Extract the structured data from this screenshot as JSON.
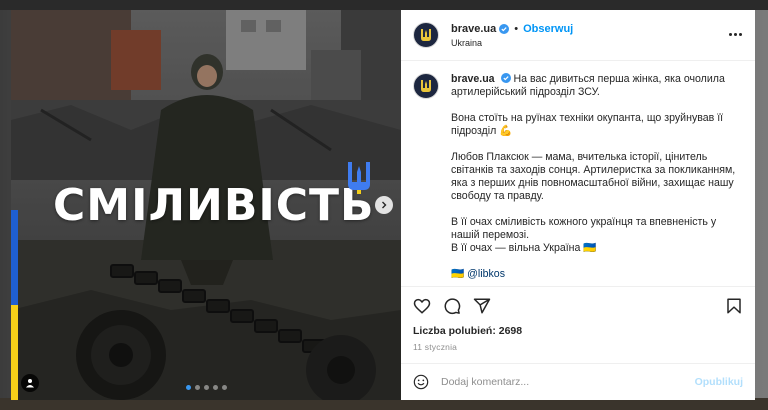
{
  "post": {
    "headline": "СМІЛИВІСТЬ",
    "dots_count": 5,
    "active_dot": 0
  },
  "header": {
    "username": "brave.ua",
    "separator": "•",
    "follow_label": "Obserwuj",
    "location": "Ukraina"
  },
  "caption": {
    "username": "brave.ua",
    "line1": "На вас дивиться перша жінка, яка очолила артилерійський підрозділ ЗСУ.",
    "para2": "Вона стоїть на руїнах техніки окупанта, що зруйнував її підрозділ 💪",
    "para3": "Любов Плаксюк — мама, вчителька історії, цінитель світанків та заходів сонця. Артилеристка за покликанням, яка з перших днів повномасштабної війни, захищає нашу свободу та правду.",
    "para4a": "В її очах сміливість кожного українця та впевненість у нашій перемозі.",
    "para4b": "В її очах — вільна Україна 🇺🇦",
    "mention_flag": "🇺🇦",
    "mention": "@libkos"
  },
  "actions": {
    "likes": "Liczba polubień: 2698",
    "date": "11 stycznia"
  },
  "comment": {
    "placeholder": "Dodaj komentarz...",
    "publish_label": "Opublikuj"
  },
  "colors": {
    "accent": "#0095f6",
    "flag_blue": "#1f5fd1",
    "flag_yellow": "#f5cf19",
    "publish_disabled": "#b2dffc"
  },
  "icons": [
    "verified-badge-icon",
    "more-options-icon",
    "heart-icon",
    "comment-icon",
    "share-icon",
    "bookmark-icon",
    "emoji-icon",
    "chevron-right-icon",
    "user-tag-icon",
    "trident-icon"
  ]
}
